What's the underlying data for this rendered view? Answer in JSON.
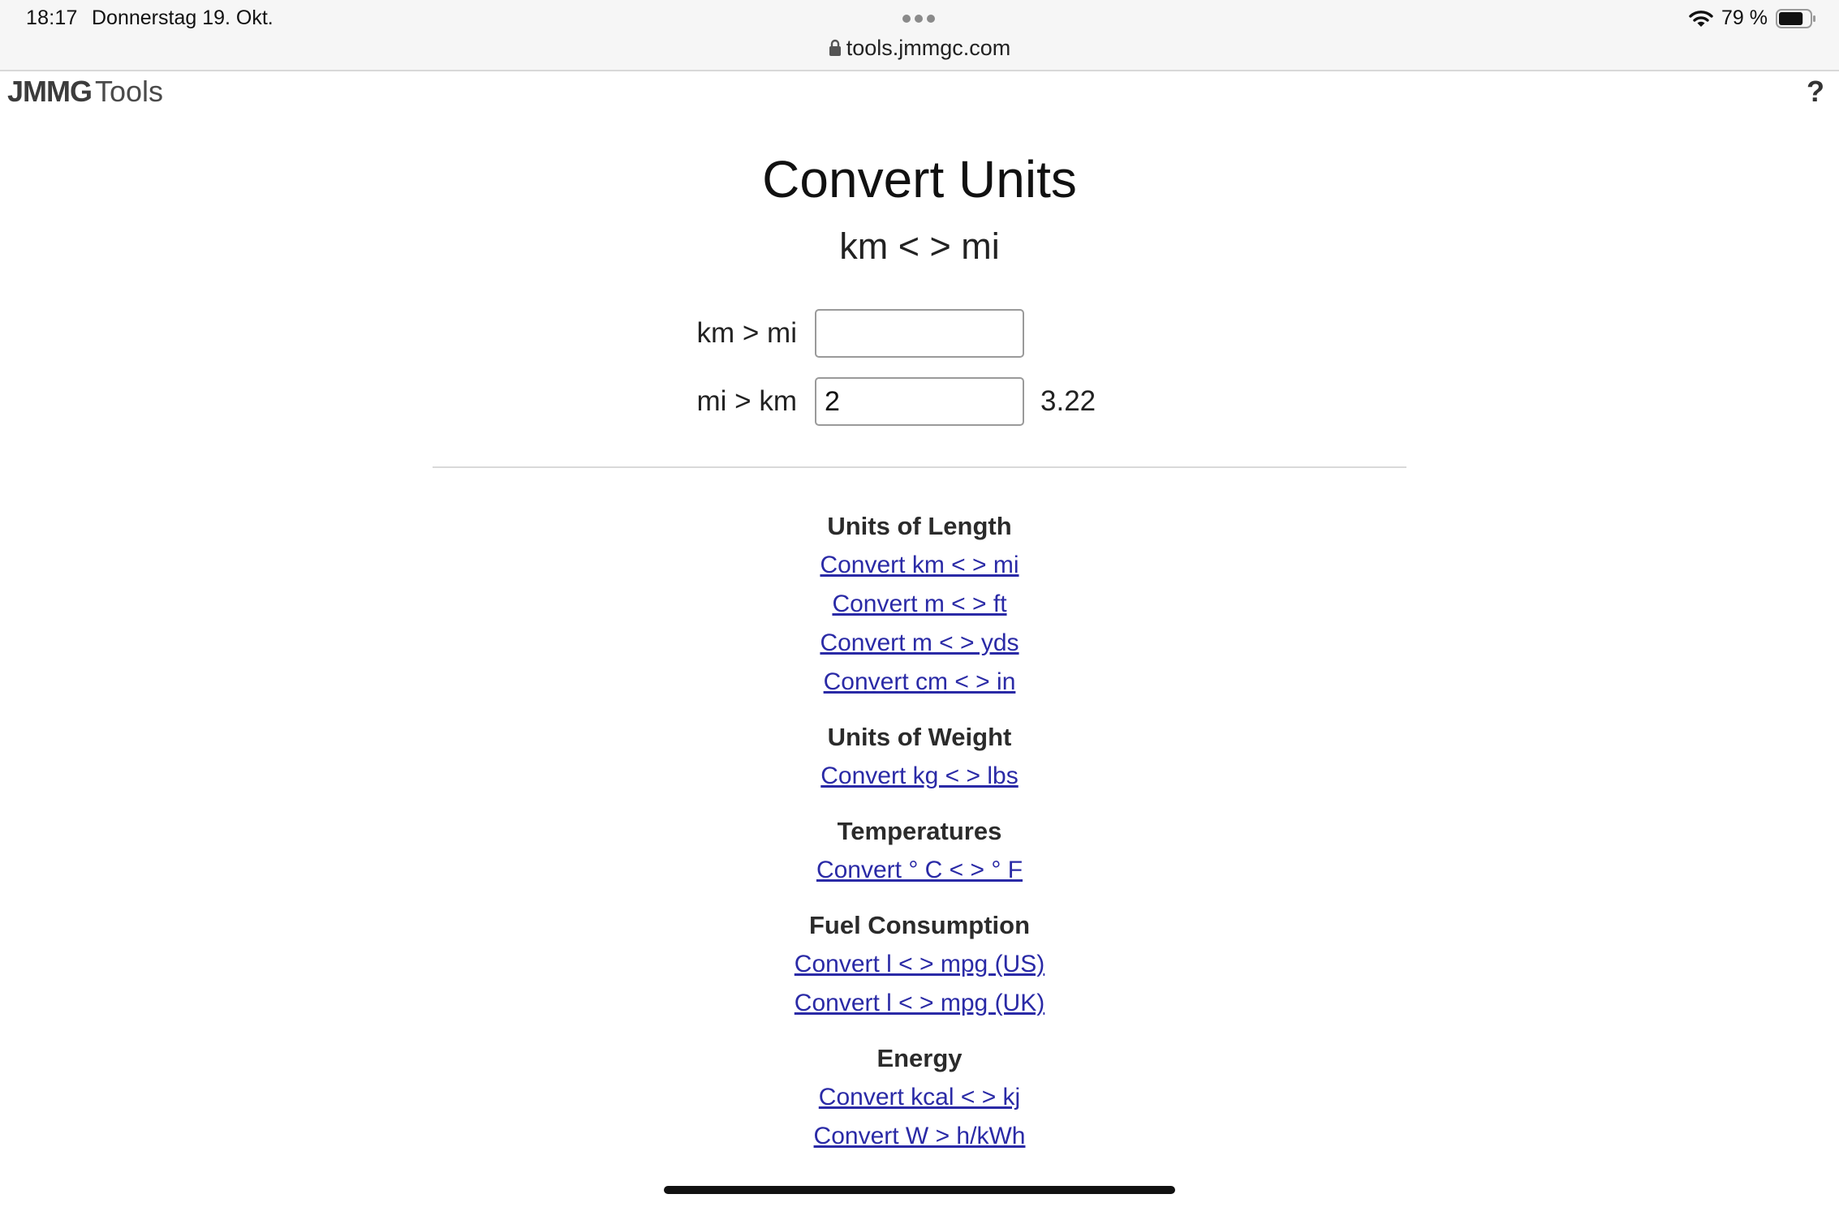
{
  "status_bar": {
    "time": "18:17",
    "date": "Donnerstag 19. Okt.",
    "battery_percent": "79 %",
    "battery_level": 0.79,
    "url": "tools.jmmgc.com"
  },
  "header": {
    "logo_bold": "JMMG",
    "logo_light": "Tools",
    "help_label": "?"
  },
  "main": {
    "title": "Convert Units",
    "subtitle": "km < > mi",
    "rows": [
      {
        "label": "km > mi",
        "value": "",
        "result": ""
      },
      {
        "label": "mi > km",
        "value": "2",
        "result": "3.22"
      }
    ]
  },
  "sections": [
    {
      "heading": "Units of Length",
      "links": [
        "Convert km < > mi",
        "Convert m < > ft",
        "Convert m < > yds",
        "Convert cm < > in"
      ]
    },
    {
      "heading": "Units of Weight",
      "links": [
        "Convert kg < > lbs"
      ]
    },
    {
      "heading": "Temperatures",
      "links": [
        "Convert ° C < > ° F"
      ]
    },
    {
      "heading": "Fuel Consumption",
      "links": [
        "Convert l < > mpg (US)",
        "Convert l < > mpg (UK)"
      ]
    },
    {
      "heading": "Energy",
      "links": [
        "Convert kcal < > kj",
        "Convert W > h/kWh"
      ]
    }
  ],
  "colors": {
    "link": "#2a2aa6",
    "status_bar_bg": "#f6f6f6"
  }
}
